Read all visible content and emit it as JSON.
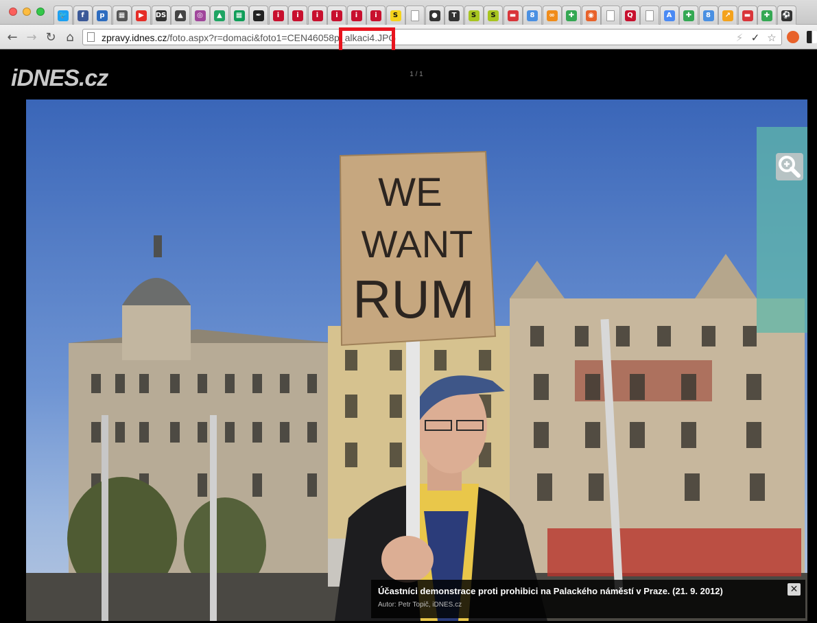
{
  "browser": {
    "tabs": [
      {
        "icon": "twitter-icon",
        "glyph": "🐦",
        "color": "#1da1f2"
      },
      {
        "icon": "facebook-icon",
        "glyph": "f",
        "color": "#3b5998"
      },
      {
        "icon": "pinboard-icon",
        "glyph": "p",
        "color": "#2d6cbf"
      },
      {
        "icon": "calculator-icon",
        "glyph": "▦",
        "color": "#555555"
      },
      {
        "icon": "youtube-icon",
        "glyph": "▶",
        "color": "#e52d27"
      },
      {
        "icon": "ds-icon",
        "glyph": "DS",
        "color": "#333333"
      },
      {
        "icon": "mountain-icon",
        "glyph": "▲",
        "color": "#444444"
      },
      {
        "icon": "swirl-icon",
        "glyph": "◎",
        "color": "#a0469b"
      },
      {
        "icon": "google-drive-icon",
        "glyph": "▲",
        "color": "#1fa463"
      },
      {
        "icon": "sheets-icon",
        "glyph": "▦",
        "color": "#0f9d58"
      },
      {
        "icon": "feather-icon",
        "glyph": "✒",
        "color": "#222222"
      },
      {
        "icon": "idnes-icon",
        "glyph": "i",
        "color": "#c8102e"
      },
      {
        "icon": "idnes-icon",
        "glyph": "i",
        "color": "#c8102e"
      },
      {
        "icon": "idnes-icon",
        "glyph": "i",
        "color": "#c8102e"
      },
      {
        "icon": "idnes-icon",
        "glyph": "i",
        "color": "#c8102e"
      },
      {
        "icon": "idnes-icon",
        "glyph": "i",
        "color": "#c8102e"
      },
      {
        "icon": "idnes-icon",
        "glyph": "i",
        "color": "#c8102e"
      },
      {
        "icon": "s-yellow-icon",
        "glyph": "S",
        "color": "#f5d31b"
      },
      {
        "icon": "blank-page-icon",
        "glyph": "",
        "color": "#ffffff"
      },
      {
        "icon": "github-icon",
        "glyph": "●",
        "color": "#333333"
      },
      {
        "icon": "t-icon",
        "glyph": "T",
        "color": "#333333"
      },
      {
        "icon": "s-green-icon",
        "glyph": "S",
        "color": "#a8c520"
      },
      {
        "icon": "s-green-icon",
        "glyph": "S",
        "color": "#a8c520"
      },
      {
        "icon": "flag-icon",
        "glyph": "▬",
        "color": "#d9353a"
      },
      {
        "icon": "google-icon",
        "glyph": "8",
        "color": "#4a90e2"
      },
      {
        "icon": "owl-icon",
        "glyph": "∞",
        "color": "#f08c1a"
      },
      {
        "icon": "maps-icon",
        "glyph": "✚",
        "color": "#34a853"
      },
      {
        "icon": "swirl-orange-icon",
        "glyph": "◉",
        "color": "#e8622a"
      },
      {
        "icon": "blank-page-icon",
        "glyph": "",
        "color": "#ffffff"
      },
      {
        "icon": "q-icon",
        "glyph": "Q",
        "color": "#c8102e"
      },
      {
        "icon": "blank-page-icon",
        "glyph": "",
        "color": "#ffffff"
      },
      {
        "icon": "translate-icon",
        "glyph": "A",
        "color": "#4a8af4"
      },
      {
        "icon": "maps-icon",
        "glyph": "✚",
        "color": "#34a853"
      },
      {
        "icon": "google-icon",
        "glyph": "8",
        "color": "#4a90e2"
      },
      {
        "icon": "chart-icon",
        "glyph": "↗",
        "color": "#f4a21b"
      },
      {
        "icon": "flag-icon",
        "glyph": "▬",
        "color": "#d9353a"
      },
      {
        "icon": "maps-icon",
        "glyph": "✚",
        "color": "#34a853"
      },
      {
        "icon": "soccer-icon",
        "glyph": "⚽",
        "color": "#333333"
      }
    ],
    "url_host": "zpravy.idnes.cz",
    "url_path": "/foto.aspx?r=domaci&foto1=CEN46058p_alkaci4.JPG"
  },
  "viewer": {
    "logo": "iDNES.cz",
    "counter": "1 / 1",
    "sign_lines": [
      "WE",
      "WANT",
      "RUM"
    ],
    "caption_title": "Účastníci demonstrace proti prohibici na Palackého náměstí v Praze. (21. 9. 2012)",
    "caption_author": "Autor: Petr Topič, iDNES.cz",
    "close_glyph": "✕"
  },
  "colors": {
    "highlight": "#e8141d",
    "sky": "#3a66b8"
  }
}
